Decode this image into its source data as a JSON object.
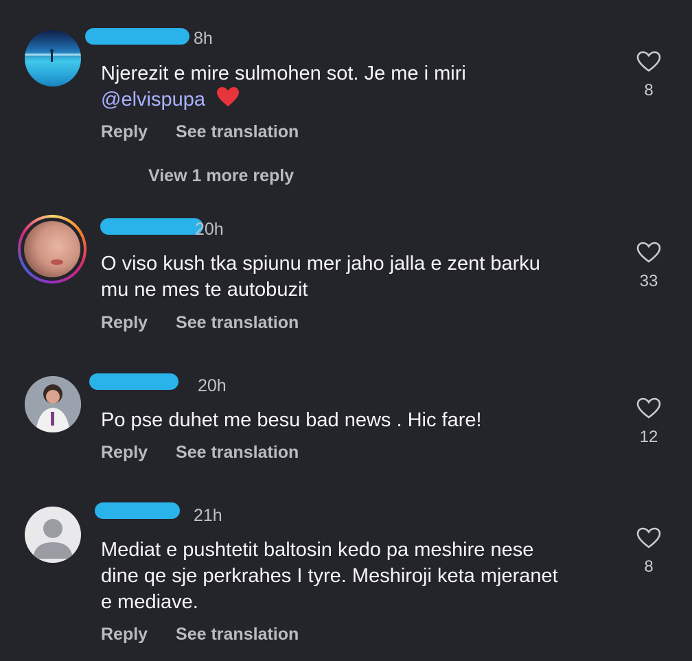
{
  "comments": [
    {
      "time": "8h",
      "text": "Njerezit e mire sulmohen sot. Je me i miri",
      "mention": "@elvispupa",
      "reply_label": "Reply",
      "translate_label": "See translation",
      "likes": "8"
    },
    {
      "time": "20h",
      "text_line1": "O viso kush tka spiunu mer jaho jalla e zent barku",
      "text_line2": "mu ne mes te autobuzit",
      "reply_label": "Reply",
      "translate_label": "See translation",
      "likes": "33"
    },
    {
      "time": "20h",
      "text": "Po pse duhet me besu bad news . Hic fare!",
      "reply_label": "Reply",
      "translate_label": "See translation",
      "likes": "12"
    },
    {
      "time": "21h",
      "text_line1": "Mediat e pushtetit baltosin kedo pa meshire nese",
      "text_line2": "dine qe sje perkrahes I tyre. Meshiroji keta mjeranet",
      "text_line3": "e mediave.",
      "reply_label": "Reply",
      "translate_label": "See translation",
      "likes": "8"
    }
  ],
  "view_more_replies": "View 1 more reply",
  "icons": {
    "like": "heart-outline-icon",
    "emoji": "red-heart-emoji",
    "default_avatar": "person-silhouette-icon"
  },
  "colors": {
    "background": "#24252b",
    "mention": "#a9b3ff",
    "redaction": "#2ab3ea",
    "story_ring": "#e1306c"
  }
}
